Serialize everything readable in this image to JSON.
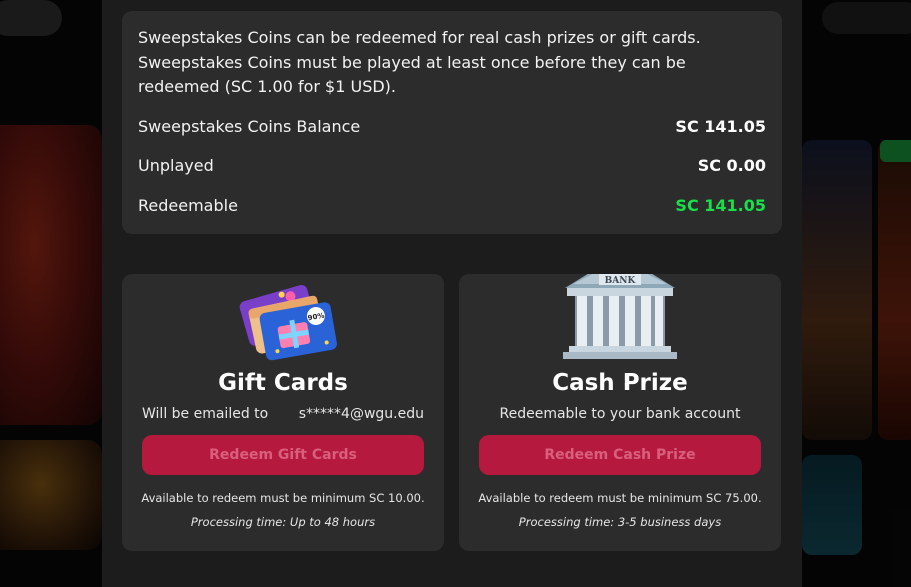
{
  "info": {
    "description": "Sweepstakes Coins can be redeemed for real cash prizes or gift cards. Sweepstakes Coins must be played at least once before they can be redeemed (SC 1.00 for $1 USD).",
    "rows": [
      {
        "label": "Sweepstakes Coins Balance",
        "value": "SC 141.05"
      },
      {
        "label": "Unplayed",
        "value": "SC 0.00"
      },
      {
        "label": "Redeemable",
        "value": "SC 141.05"
      }
    ],
    "highlight_color": "#19e04a"
  },
  "gift_card": {
    "icon": "gift-cards-icon",
    "badge_text": "90%",
    "title": "Gift Cards",
    "subtitle_label": "Will be emailed to",
    "email": "s*****4@wgu.edu",
    "button_label": "Redeem Gift Cards",
    "minimum_note": "Available to redeem must be minimum SC 10.00.",
    "processing_time": "Processing time: Up to 48 hours"
  },
  "cash_prize": {
    "icon": "bank-icon",
    "bank_sign": "BANK",
    "title": "Cash Prize",
    "subtitle": "Redeemable to your bank account",
    "button_label": "Redeem Cash Prize",
    "minimum_note": "Available to redeem must be minimum SC 75.00.",
    "processing_time": "Processing time: 3-5 business days"
  },
  "colors": {
    "button": "#b5193e",
    "panel": "#2c2c2c",
    "modal": "#1c1c1c"
  }
}
